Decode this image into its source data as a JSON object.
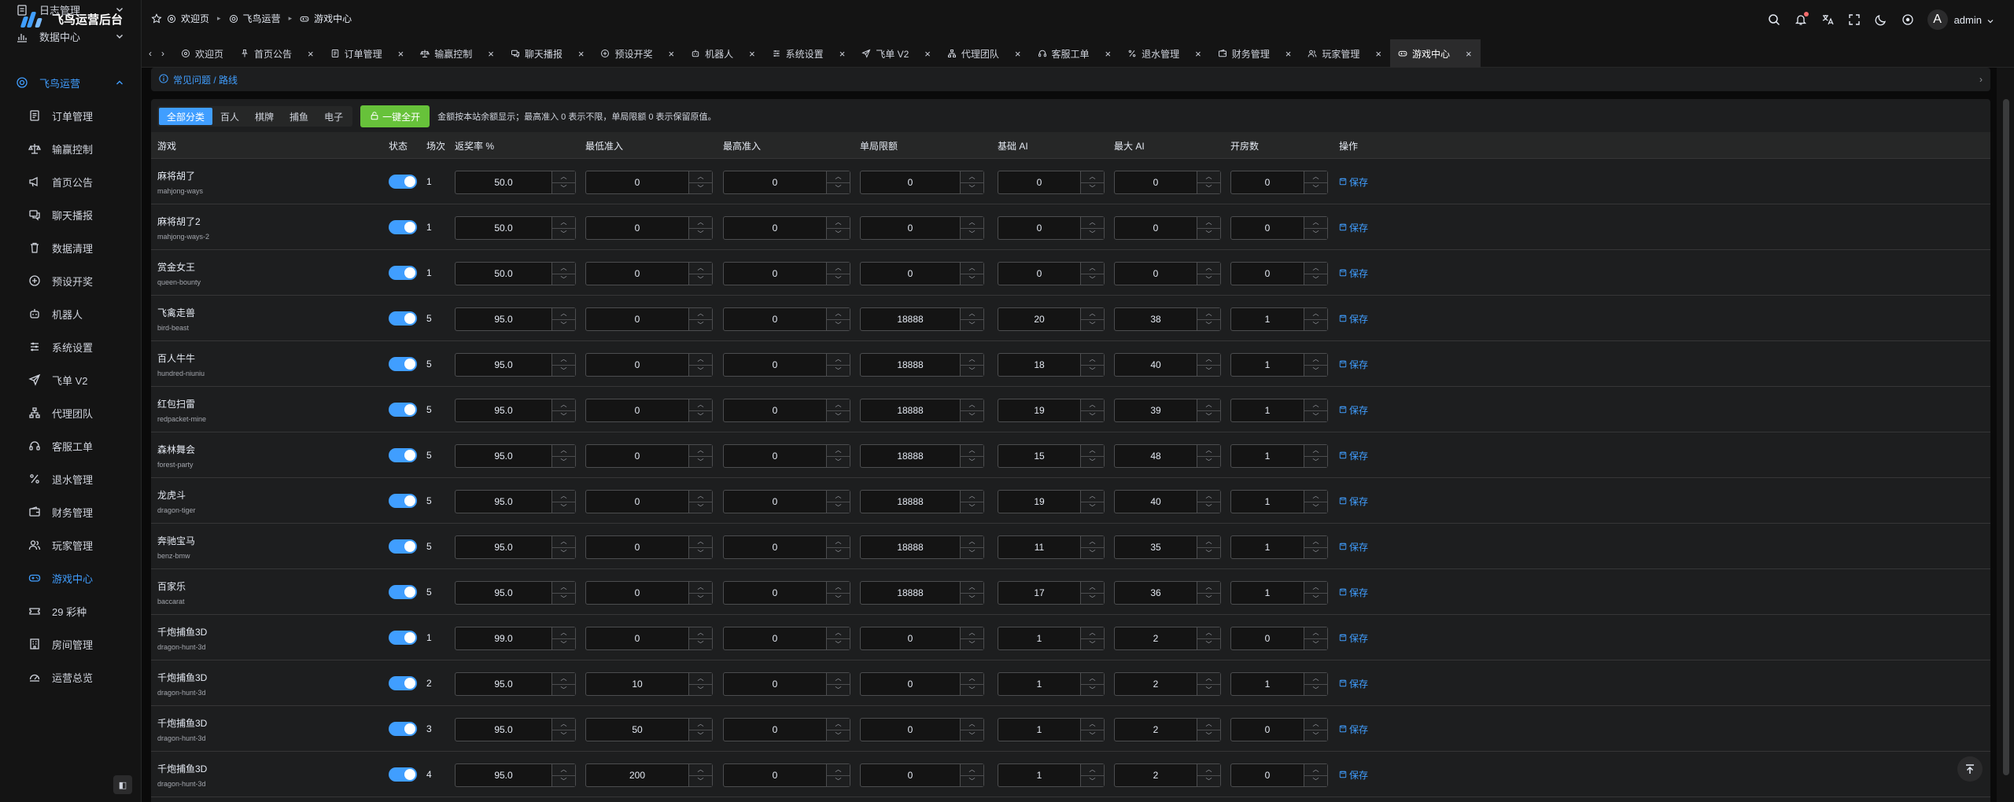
{
  "app": {
    "title": "飞鸟运营后台"
  },
  "sidebar": {
    "items": [
      {
        "label": "日志管理",
        "icon": "log-icon",
        "level": "top",
        "arrow": "down"
      },
      {
        "label": "数据中心",
        "icon": "chart-icon",
        "level": "top",
        "arrow": "down"
      },
      {
        "label": "飞鸟运营",
        "icon": "target-icon",
        "level": "top",
        "arrow": "up",
        "open": true
      },
      {
        "label": "订单管理",
        "icon": "document-icon",
        "level": "sub"
      },
      {
        "label": "输赢控制",
        "icon": "scale-icon",
        "level": "sub"
      },
      {
        "label": "首页公告",
        "icon": "megaphone-icon",
        "level": "sub"
      },
      {
        "label": "聊天播报",
        "icon": "chat-icon",
        "level": "sub"
      },
      {
        "label": "数据清理",
        "icon": "trash-icon",
        "level": "sub"
      },
      {
        "label": "预设开奖",
        "icon": "plus-circle-icon",
        "level": "sub"
      },
      {
        "label": "机器人",
        "icon": "robot-icon",
        "level": "sub"
      },
      {
        "label": "系统设置",
        "icon": "sliders-icon",
        "level": "sub"
      },
      {
        "label": "飞单 V2",
        "icon": "send-icon",
        "level": "sub"
      },
      {
        "label": "代理团队",
        "icon": "network-icon",
        "level": "sub"
      },
      {
        "label": "客服工单",
        "icon": "headset-icon",
        "level": "sub"
      },
      {
        "label": "退水管理",
        "icon": "percent-icon",
        "level": "sub"
      },
      {
        "label": "财务管理",
        "icon": "wallet-icon",
        "level": "sub"
      },
      {
        "label": "玩家管理",
        "icon": "users-icon",
        "level": "sub"
      },
      {
        "label": "游戏中心",
        "icon": "gamepad-icon",
        "level": "sub",
        "active": true
      },
      {
        "label": "29 彩种",
        "icon": "lottery-icon",
        "level": "sub"
      },
      {
        "label": "房间管理",
        "icon": "building-icon",
        "level": "sub"
      },
      {
        "label": "运营总览",
        "icon": "dashboard-icon",
        "level": "sub"
      }
    ],
    "collapse_label": "◧"
  },
  "header": {
    "breadcrumb": [
      {
        "label": "欢迎页",
        "icon": "home-icon"
      },
      {
        "label": "飞鸟运营",
        "icon": "target-icon"
      },
      {
        "label": "游戏中心",
        "icon": "gamepad-icon"
      }
    ],
    "username": "admin",
    "avatar_letter": "A"
  },
  "tabs": [
    {
      "label": "欢迎页",
      "icon": "home-icon",
      "closable": false
    },
    {
      "label": "首页公告",
      "icon": "pin-icon",
      "closable": true
    },
    {
      "label": "订单管理",
      "icon": "document-icon",
      "closable": true
    },
    {
      "label": "输赢控制",
      "icon": "scale-icon",
      "closable": true
    },
    {
      "label": "聊天播报",
      "icon": "chat-icon",
      "closable": true
    },
    {
      "label": "预设开奖",
      "icon": "plus-circle-icon",
      "closable": true
    },
    {
      "label": "机器人",
      "icon": "robot-icon",
      "closable": true
    },
    {
      "label": "系统设置",
      "icon": "sliders-icon",
      "closable": true
    },
    {
      "label": "飞单 V2",
      "icon": "send-icon",
      "closable": true
    },
    {
      "label": "代理团队",
      "icon": "network-icon",
      "closable": true
    },
    {
      "label": "客服工单",
      "icon": "headset-icon",
      "closable": true
    },
    {
      "label": "退水管理",
      "icon": "percent-icon",
      "closable": true
    },
    {
      "label": "财务管理",
      "icon": "wallet-icon",
      "closable": true
    },
    {
      "label": "玩家管理",
      "icon": "users-icon",
      "closable": true
    },
    {
      "label": "游戏中心",
      "icon": "gamepad-icon",
      "closable": true,
      "active": true
    }
  ],
  "notice": {
    "text": "常见问题 / 路线"
  },
  "filters": {
    "categories": [
      "全部分类",
      "百人",
      "棋牌",
      "捕鱼",
      "电子"
    ],
    "selected": "全部分类",
    "open_all_label": "一键全开",
    "tip": "金额按本站余额显示；最高准入 0 表示不限，单局限额 0 表示保留原值。"
  },
  "table": {
    "columns": [
      "游戏",
      "状态",
      "场次",
      "返奖率 %",
      "最低准入",
      "最高准入",
      "单局限额",
      "基础 AI",
      "最大 AI",
      "开房数",
      "操作"
    ],
    "save_label": "保存",
    "rows": [
      {
        "name": "麻将胡了",
        "slug": "mahjong-ways",
        "enabled": true,
        "session": "1",
        "rtp": "50.0",
        "min_entry": "0",
        "max_entry": "0",
        "bet_limit": "0",
        "base_ai": "0",
        "max_ai": "0",
        "rooms": "0"
      },
      {
        "name": "麻将胡了2",
        "slug": "mahjong-ways-2",
        "enabled": true,
        "session": "1",
        "rtp": "50.0",
        "min_entry": "0",
        "max_entry": "0",
        "bet_limit": "0",
        "base_ai": "0",
        "max_ai": "0",
        "rooms": "0"
      },
      {
        "name": "赏金女王",
        "slug": "queen-bounty",
        "enabled": true,
        "session": "1",
        "rtp": "50.0",
        "min_entry": "0",
        "max_entry": "0",
        "bet_limit": "0",
        "base_ai": "0",
        "max_ai": "0",
        "rooms": "0"
      },
      {
        "name": "飞禽走兽",
        "slug": "bird-beast",
        "enabled": true,
        "session": "5",
        "rtp": "95.0",
        "min_entry": "0",
        "max_entry": "0",
        "bet_limit": "18888",
        "base_ai": "20",
        "max_ai": "38",
        "rooms": "1"
      },
      {
        "name": "百人牛牛",
        "slug": "hundred-niuniu",
        "enabled": true,
        "session": "5",
        "rtp": "95.0",
        "min_entry": "0",
        "max_entry": "0",
        "bet_limit": "18888",
        "base_ai": "18",
        "max_ai": "40",
        "rooms": "1"
      },
      {
        "name": "红包扫雷",
        "slug": "redpacket-mine",
        "enabled": true,
        "session": "5",
        "rtp": "95.0",
        "min_entry": "0",
        "max_entry": "0",
        "bet_limit": "18888",
        "base_ai": "19",
        "max_ai": "39",
        "rooms": "1"
      },
      {
        "name": "森林舞会",
        "slug": "forest-party",
        "enabled": true,
        "session": "5",
        "rtp": "95.0",
        "min_entry": "0",
        "max_entry": "0",
        "bet_limit": "18888",
        "base_ai": "15",
        "max_ai": "48",
        "rooms": "1"
      },
      {
        "name": "龙虎斗",
        "slug": "dragon-tiger",
        "enabled": true,
        "session": "5",
        "rtp": "95.0",
        "min_entry": "0",
        "max_entry": "0",
        "bet_limit": "18888",
        "base_ai": "19",
        "max_ai": "40",
        "rooms": "1"
      },
      {
        "name": "奔驰宝马",
        "slug": "benz-bmw",
        "enabled": true,
        "session": "5",
        "rtp": "95.0",
        "min_entry": "0",
        "max_entry": "0",
        "bet_limit": "18888",
        "base_ai": "11",
        "max_ai": "35",
        "rooms": "1"
      },
      {
        "name": "百家乐",
        "slug": "baccarat",
        "enabled": true,
        "session": "5",
        "rtp": "95.0",
        "min_entry": "0",
        "max_entry": "0",
        "bet_limit": "18888",
        "base_ai": "17",
        "max_ai": "36",
        "rooms": "1"
      },
      {
        "name": "千炮捕鱼3D",
        "slug": "dragon-hunt-3d",
        "enabled": true,
        "session": "1",
        "rtp": "99.0",
        "min_entry": "0",
        "max_entry": "0",
        "bet_limit": "0",
        "base_ai": "1",
        "max_ai": "2",
        "rooms": "0"
      },
      {
        "name": "千炮捕鱼3D",
        "slug": "dragon-hunt-3d",
        "enabled": true,
        "session": "2",
        "rtp": "95.0",
        "min_entry": "10",
        "max_entry": "0",
        "bet_limit": "0",
        "base_ai": "1",
        "max_ai": "2",
        "rooms": "1"
      },
      {
        "name": "千炮捕鱼3D",
        "slug": "dragon-hunt-3d",
        "enabled": true,
        "session": "3",
        "rtp": "95.0",
        "min_entry": "50",
        "max_entry": "0",
        "bet_limit": "0",
        "base_ai": "1",
        "max_ai": "2",
        "rooms": "0"
      },
      {
        "name": "千炮捕鱼3D",
        "slug": "dragon-hunt-3d",
        "enabled": true,
        "session": "4",
        "rtp": "95.0",
        "min_entry": "200",
        "max_entry": "0",
        "bet_limit": "0",
        "base_ai": "1",
        "max_ai": "2",
        "rooms": "0"
      }
    ]
  },
  "colors": {
    "accent": "#409eff",
    "success": "#67c23a",
    "background": "#141414",
    "card": "#1d1e1f"
  }
}
